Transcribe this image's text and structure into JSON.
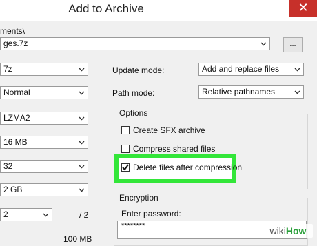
{
  "window": {
    "title": "Add to Archive",
    "close_glyph": "✕"
  },
  "archive": {
    "path_label": "ments\\",
    "filename": "ges.7z",
    "browse_label": "..."
  },
  "left_fields": [
    {
      "value": "7z"
    },
    {
      "value": "Normal"
    },
    {
      "value": "LZMA2"
    },
    {
      "value": "16 MB"
    },
    {
      "value": "32"
    },
    {
      "value": "2 GB"
    },
    {
      "value": "2"
    }
  ],
  "left_extra": {
    "threads_suffix": "/ 2",
    "memory_usage": "100 MB"
  },
  "update_mode": {
    "label": "Update mode:",
    "value": "Add and replace files"
  },
  "path_mode": {
    "label": "Path mode:",
    "value": "Relative pathnames"
  },
  "options": {
    "title": "Options",
    "items": [
      {
        "label": "Create SFX archive",
        "checked": false
      },
      {
        "label": "Compress shared files",
        "checked": false
      },
      {
        "label": "Delete files after compression",
        "checked": true
      }
    ]
  },
  "encryption": {
    "title": "Encryption",
    "password_label": "Enter password:",
    "password_value": "********"
  },
  "watermark": {
    "wiki": "wiki",
    "how": "How"
  },
  "colors": {
    "highlight": "#33e639",
    "close": "#c7302a"
  }
}
